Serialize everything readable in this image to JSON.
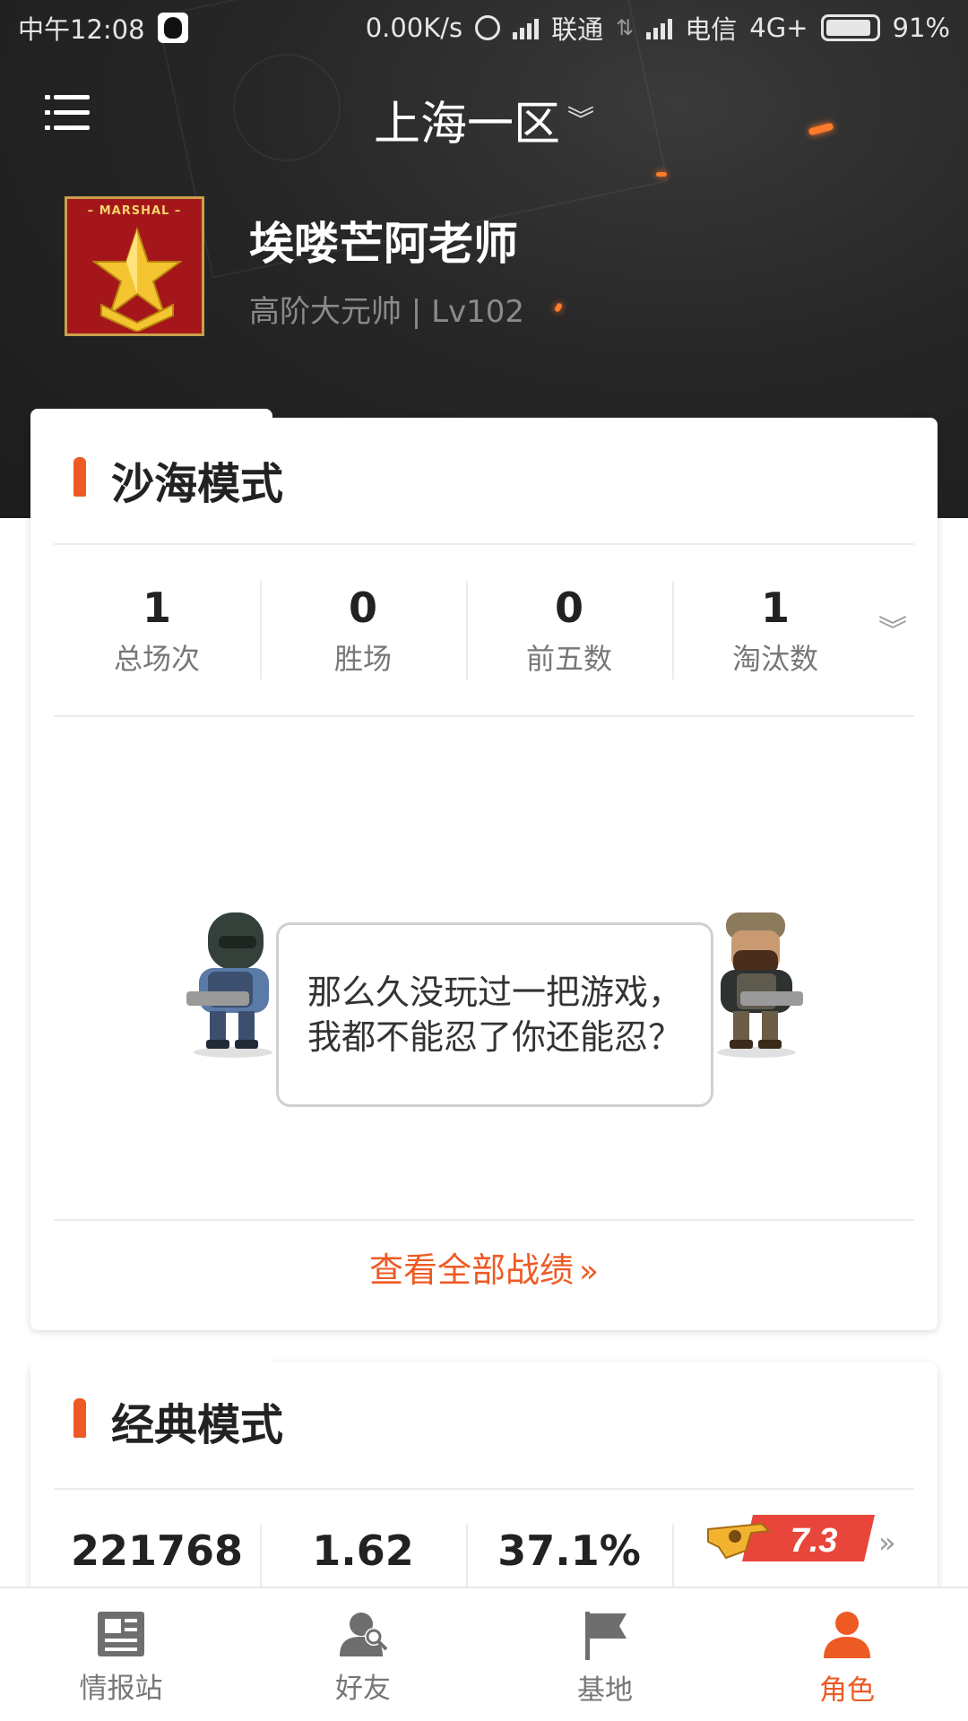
{
  "status_bar": {
    "time": "中午12:08",
    "network_speed": "0.00K/s",
    "carrier1": "联通",
    "carrier2": "电信",
    "net_type": "4G+",
    "battery": "91%"
  },
  "header": {
    "server": "上海一区",
    "badge_text": "– MARSHAL –",
    "player_name": "埃喽芒阿老师",
    "player_rank": "高阶大元帅 | Lv102"
  },
  "desert_mode": {
    "title": "沙海模式",
    "stats": [
      {
        "value": "1",
        "label": "总场次"
      },
      {
        "value": "0",
        "label": "胜场"
      },
      {
        "value": "0",
        "label": "前五数"
      },
      {
        "value": "1",
        "label": "淘汰数"
      }
    ],
    "empty_message": "那么久没玩过一把游戏，我都不能忍了你还能忍？",
    "view_all": "查看全部战绩"
  },
  "classic_mode": {
    "title": "经典模式",
    "stats": [
      {
        "value": "221768"
      },
      {
        "value": "1.62"
      },
      {
        "value": "37.1%"
      }
    ],
    "rating": "7.3"
  },
  "bottom_nav": [
    {
      "label": "情报站",
      "icon": "news-icon"
    },
    {
      "label": "好友",
      "icon": "friends-icon"
    },
    {
      "label": "基地",
      "icon": "flag-icon"
    },
    {
      "label": "角色",
      "icon": "person-icon",
      "active": true
    }
  ],
  "colors": {
    "accent": "#ee5a24",
    "header_bg": "#262626",
    "badge_red": "#a5161b",
    "badge_gold": "#f4c531"
  }
}
